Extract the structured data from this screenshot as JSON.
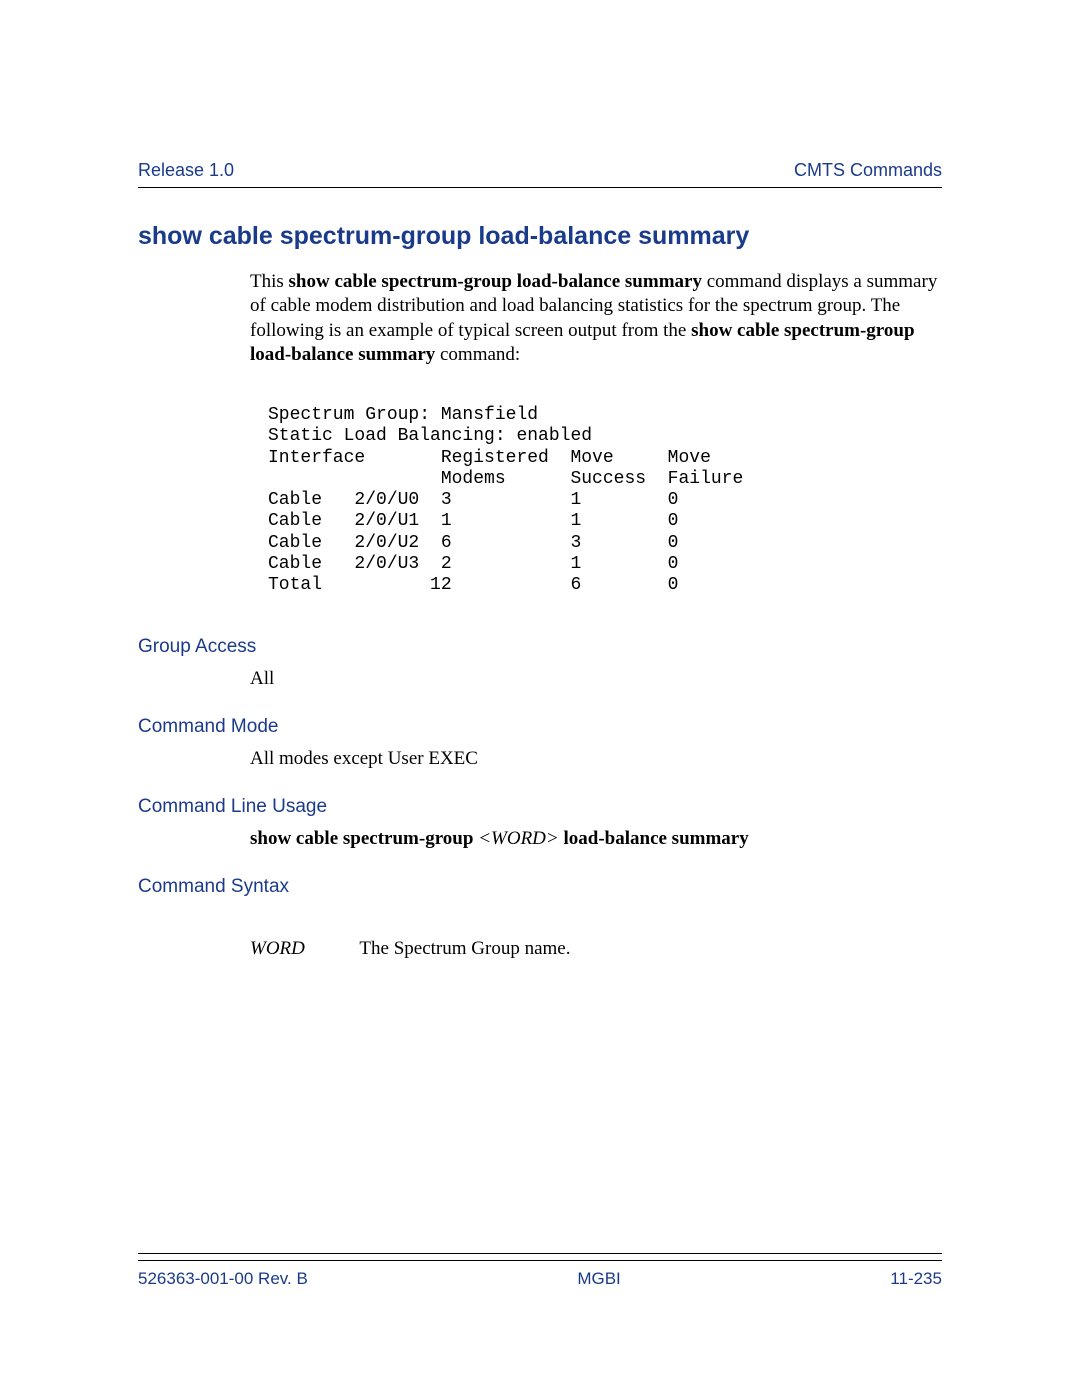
{
  "header": {
    "left": "Release 1.0",
    "right": "CMTS Commands"
  },
  "title": "show cable spectrum-group load-balance summary",
  "intro": {
    "p1a": "This ",
    "p1b_bold": "show cable spectrum-group load-balance summary",
    "p1c": " command displays a summary of cable modem distribution and load balancing statistics for the spectrum group. The following is an example of typical screen output from the ",
    "p1d_bold": "show cable spectrum-group load-balance summary",
    "p1e": " command:"
  },
  "output_block": "Spectrum Group: Mansfield\nStatic Load Balancing: enabled\nInterface       Registered  Move     Move\n                Modems      Success  Failure\nCable   2/0/U0  3           1        0\nCable   2/0/U1  1           1        0\nCable   2/0/U2  6           3        0\nCable   2/0/U3  2           1        0\nTotal          12           6        0",
  "sections": {
    "group_access": {
      "label": "Group Access",
      "value": "All"
    },
    "command_mode": {
      "label": "Command Mode",
      "value": "All modes except User EXEC"
    },
    "cmd_line_usage": {
      "label": "Command Line Usage",
      "prefix": "show cable spectrum-group ",
      "lt": "<",
      "word": "WORD",
      "gt": ">",
      "suffix": " load-balance summary"
    },
    "cmd_syntax": {
      "label": "Command Syntax",
      "term": "WORD",
      "desc": "The Spectrum Group name."
    }
  },
  "footer": {
    "left": "526363-001-00 Rev. B",
    "center": "MGBI",
    "right": "11-235"
  }
}
